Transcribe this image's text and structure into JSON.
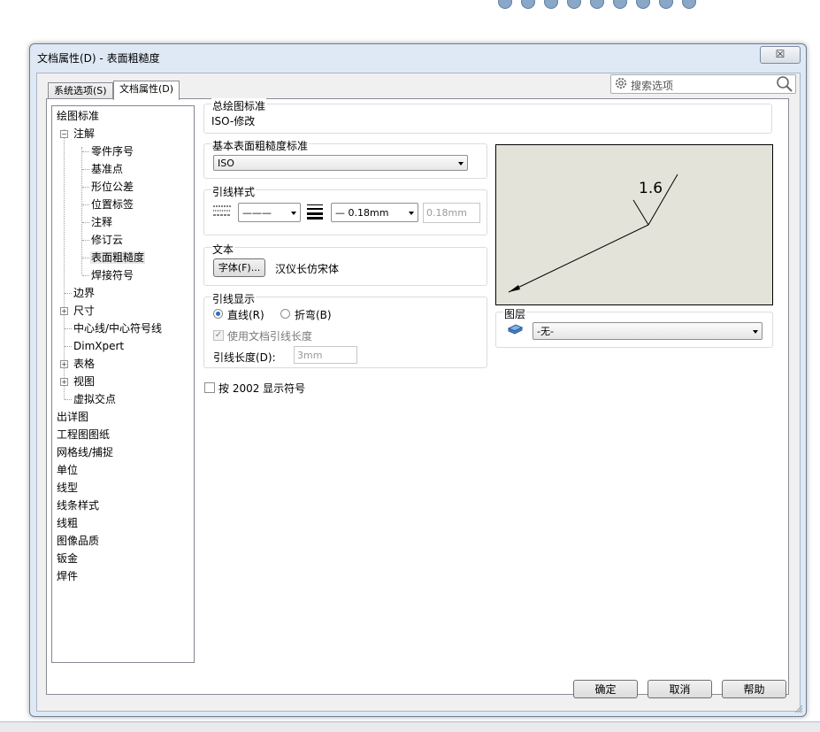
{
  "window": {
    "title": "文档属性(D) - 表面粗糙度",
    "close_glyph": "☒"
  },
  "tabs": [
    {
      "label": "系统选项(S)"
    },
    {
      "label": "文档属性(D)"
    }
  ],
  "search": {
    "placeholder": "搜索选项"
  },
  "tree": [
    {
      "label": "绘图标准"
    },
    {
      "label": "注解"
    },
    {
      "label": "零件序号"
    },
    {
      "label": "基准点"
    },
    {
      "label": "形位公差"
    },
    {
      "label": "位置标签"
    },
    {
      "label": "注释"
    },
    {
      "label": "修订云"
    },
    {
      "label": "表面粗糙度"
    },
    {
      "label": "焊接符号"
    },
    {
      "label": "边界"
    },
    {
      "label": "尺寸"
    },
    {
      "label": "中心线/中心符号线"
    },
    {
      "label": "DimXpert"
    },
    {
      "label": "表格"
    },
    {
      "label": "视图"
    },
    {
      "label": "虚拟交点"
    },
    {
      "label": "出详图"
    },
    {
      "label": "工程图图纸"
    },
    {
      "label": "网格线/捕捉"
    },
    {
      "label": "单位"
    },
    {
      "label": "线型"
    },
    {
      "label": "线条样式"
    },
    {
      "label": "线粗"
    },
    {
      "label": "图像品质"
    },
    {
      "label": "钣金"
    },
    {
      "label": "焊件"
    }
  ],
  "overall_standard": {
    "label": "总绘图标准",
    "value": "ISO-修改"
  },
  "base_standard": {
    "label": "基本表面粗糙度标准",
    "value": "ISO"
  },
  "leader_style": {
    "label": "引线样式",
    "line_style": "———",
    "thickness": "— 0.18mm",
    "custom_thickness": "0.18mm"
  },
  "text": {
    "label": "文本",
    "font_button": "字体(F)...",
    "font_name": "汉仪长仿宋体"
  },
  "leader_display": {
    "label": "引线显示",
    "straight": "直线(R)",
    "bent": "折弯(B)",
    "use_doc_length": "使用文档引线长度",
    "length_label": "引线长度(D):",
    "length_value": "3mm"
  },
  "display_2002": {
    "label": "按 2002 显示符号"
  },
  "preview": {
    "roughness_value": "1.6"
  },
  "layer": {
    "label": "图层",
    "value": "-无-"
  },
  "buttons": {
    "ok": "确定",
    "cancel": "取消",
    "help": "帮助"
  }
}
